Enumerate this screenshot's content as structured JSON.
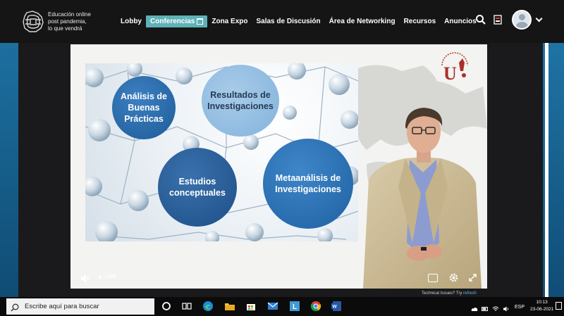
{
  "brand": {
    "line1": "Educación online",
    "line2": "post pandemia,",
    "line3": "lo que vendrá"
  },
  "nav": {
    "items": [
      {
        "label": "Lobby",
        "active": false
      },
      {
        "label": "Conferencias",
        "active": true
      },
      {
        "label": "Zona Expo",
        "active": false
      },
      {
        "label": "Salas de Discusión",
        "active": false
      },
      {
        "label": "Área de Networking",
        "active": false
      },
      {
        "label": "Recursos",
        "active": false
      },
      {
        "label": "Anuncios",
        "active": false
      }
    ],
    "accent_color": "#5fb1b8",
    "icons": [
      "search-icon",
      "flag-icon",
      "avatar",
      "chevron-down-icon"
    ]
  },
  "slide": {
    "circle1": "Análisis de Buenas Prácticas",
    "circle2": "Resultados de Investigaciones",
    "circle3": "Estudios conceptuales",
    "circle4": "Metaanálisis de Investigaciones"
  },
  "video": {
    "live_label": "LIVE",
    "credit_prefix": "Technical Issues? Try",
    "credit_link": "refresh"
  },
  "taskbar": {
    "search_placeholder": "Escribe aquí para buscar",
    "lang": "ESP",
    "time": "10:13",
    "date": "23-06-2021"
  }
}
